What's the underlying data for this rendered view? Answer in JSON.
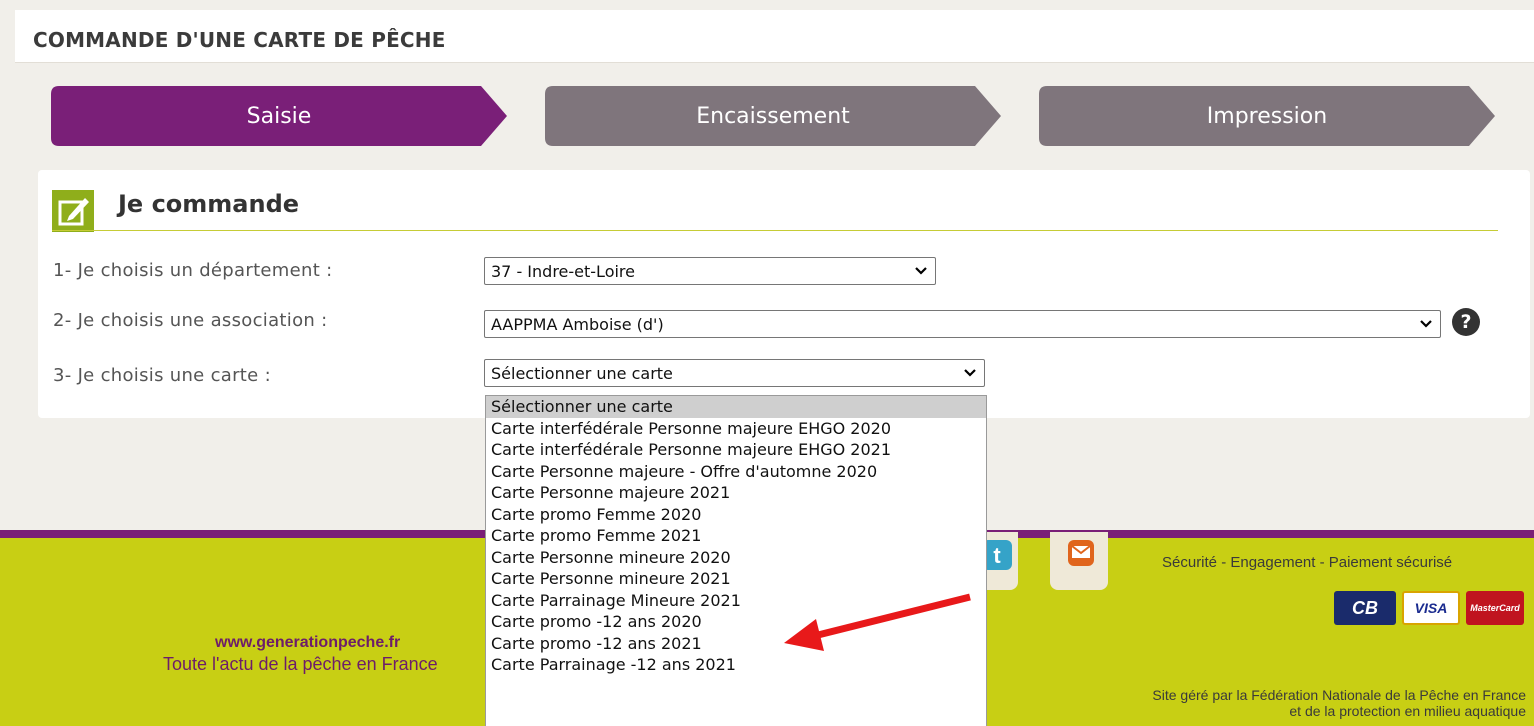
{
  "page": {
    "title": "COMMANDE D'UNE CARTE DE PÊCHE"
  },
  "steps": [
    {
      "label": "Saisie",
      "active": true,
      "color": "#7a1f78"
    },
    {
      "label": "Encaissement",
      "active": false,
      "color": "#7f757c"
    },
    {
      "label": "Impression",
      "active": false,
      "color": "#7f757c"
    }
  ],
  "section": {
    "title": "Je commande",
    "icon": "edit-icon"
  },
  "form": {
    "department": {
      "label": "1- Je choisis un département :",
      "value": "37 - Indre-et-Loire"
    },
    "association": {
      "label": "2- Je choisis une association :",
      "value": "AAPPMA Amboise (d')"
    },
    "card": {
      "label": "3- Je choisis une carte :",
      "value": "Sélectionner une carte"
    }
  },
  "dropdown_options": [
    "Sélectionner une carte",
    "Carte interfédérale Personne majeure EHGO 2020",
    "Carte interfédérale Personne majeure EHGO 2021",
    "Carte Personne majeure - Offre d'automne 2020",
    "Carte Personne majeure 2021",
    "Carte promo Femme 2020",
    "Carte promo Femme 2021",
    "Carte Personne mineure 2020",
    "Carte Personne mineure 2021",
    "Carte Parrainage Mineure 2021",
    "Carte promo -12 ans 2020",
    "Carte promo -12 ans 2021",
    "Carte Parrainage -12 ans 2021"
  ],
  "footer": {
    "url": "www.generationpeche.fr",
    "tagline": "Toute l'actu de la pêche en France",
    "security": "Sécurité - Engagement - Paiement sécurisé",
    "site_line1": "Site géré par la Fédération Nationale de la Pêche en France",
    "site_line2": "et de la protection en milieu aquatique",
    "payment_cards": [
      "CB",
      "VISA",
      "MasterCard"
    ]
  },
  "colors": {
    "accent_purple": "#7a1f78",
    "footer_green": "#c8cf14",
    "arrow_red": "#e8191a"
  }
}
